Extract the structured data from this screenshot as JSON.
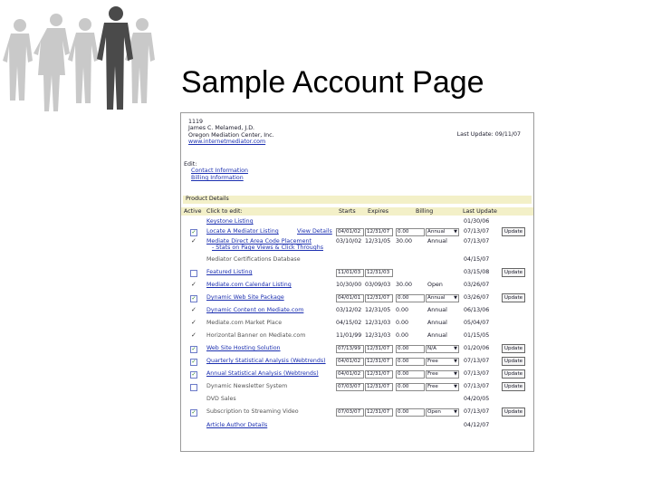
{
  "slide": {
    "title": "Sample Account Page"
  },
  "account": {
    "id": "1119",
    "name": "James C. Melamed, J.D.",
    "org": "Oregon Mediation Center, Inc.",
    "url": "www.internetmediator.com",
    "last_update": "Last Update: 09/11/07"
  },
  "edit_section": {
    "label": "Edit:",
    "links": [
      "Contact Information",
      "Billing Information"
    ]
  },
  "product_details_title": "Product Details",
  "columns": {
    "active": "Active",
    "click": "Click to edit:",
    "starts": "Starts",
    "expires": "Expires",
    "billing": "Billing",
    "last_update": "Last Update"
  },
  "rows": [
    {
      "mark": "none",
      "name": "Keystone Listing",
      "link": true,
      "last": "01/30/06"
    },
    {
      "mark": "checkbox",
      "checked": true,
      "name": "Locate A Mediator Listing",
      "link": true,
      "extra": "View Details",
      "starts": "04/01/02",
      "expires": "12/31/07",
      "amount": "0.00",
      "billing": "Annual",
      "last": "07/13/07",
      "button": "Update"
    },
    {
      "mark": "tick",
      "name": "Mediate Direct Area Code Placement",
      "name2": "- Stats on Page Views & Click Throughs",
      "link": true,
      "starts": "03/10/02",
      "expires": "12/31/05",
      "amount": "30.00",
      "billing": "Annual",
      "last": "07/13/07"
    },
    {
      "mark": "none",
      "name": "Mediator Certifications Database",
      "link": false,
      "last": "04/15/07"
    },
    {
      "mark": "checkbox",
      "checked": false,
      "name": "Featured Listing",
      "link": true,
      "starts": "11/01/03",
      "expires": "12/31/03",
      "last": "03/15/08",
      "button": "Update"
    },
    {
      "mark": "tick",
      "name": "Mediate.com Calendar Listing",
      "link": true,
      "starts": "10/30/00",
      "expires": "03/09/03",
      "amount": "30.00",
      "billing": "Open",
      "last": "03/26/07"
    },
    {
      "mark": "checkbox",
      "checked": true,
      "name": "Dynamic Web Site Package",
      "link": true,
      "starts": "04/01/01",
      "expires": "12/31/07",
      "amount": "0.00",
      "billing": "Annual",
      "last": "03/26/07",
      "button": "Update"
    },
    {
      "mark": "tick",
      "name": "Dynamic Content on Mediate.com",
      "link": true,
      "starts": "03/12/02",
      "expires": "12/31/05",
      "amount": "0.00",
      "billing": "Annual",
      "last": "06/13/06"
    },
    {
      "mark": "tick",
      "name": "Mediate.com Market Place",
      "link": false,
      "starts": "04/15/02",
      "expires": "12/31/03",
      "amount": "0.00",
      "billing": "Annual",
      "last": "05/04/07"
    },
    {
      "mark": "tick",
      "name": "Horizontal Banner on Mediate.com",
      "link": false,
      "starts": "11/01/99",
      "expires": "12/31/03",
      "amount": "0.00",
      "billing": "Annual",
      "last": "01/15/05"
    },
    {
      "mark": "checkbox",
      "checked": true,
      "name": "Web Site Hosting Solution",
      "link": true,
      "starts": "07/13/99",
      "expires": "12/31/07",
      "amount": "0.00",
      "billing": "N/A",
      "last": "01/20/06",
      "button": "Update"
    },
    {
      "mark": "checkbox",
      "checked": true,
      "name": "Quarterly Statistical Analysis (Webtrends)",
      "link": true,
      "starts": "04/01/02",
      "expires": "12/31/07",
      "amount": "0.00",
      "billing": "Free",
      "last": "07/13/07",
      "button": "Update"
    },
    {
      "mark": "checkbox",
      "checked": true,
      "name": "Annual Statistical Analysis (Webtrends)",
      "link": true,
      "starts": "04/01/02",
      "expires": "12/31/07",
      "amount": "0.00",
      "billing": "Free",
      "last": "07/13/07",
      "button": "Update"
    },
    {
      "mark": "checkbox",
      "checked": false,
      "name": "Dynamic Newsletter System",
      "link": false,
      "starts": "07/03/07",
      "expires": "12/31/07",
      "amount": "0.00",
      "billing": "Free",
      "last": "07/13/07",
      "button": "Update"
    },
    {
      "mark": "none",
      "name": "DVD Sales",
      "link": false,
      "last": "04/20/05"
    },
    {
      "mark": "checkbox",
      "checked": true,
      "name": "Subscription to Streaming Video",
      "link": false,
      "starts": "07/03/07",
      "expires": "12/31/07",
      "amount": "0.00",
      "billing": "Open",
      "last": "07/13/07",
      "button": "Update"
    },
    {
      "mark": "none",
      "name": "Article Author Details",
      "link": true,
      "last": "04/12/07"
    }
  ]
}
